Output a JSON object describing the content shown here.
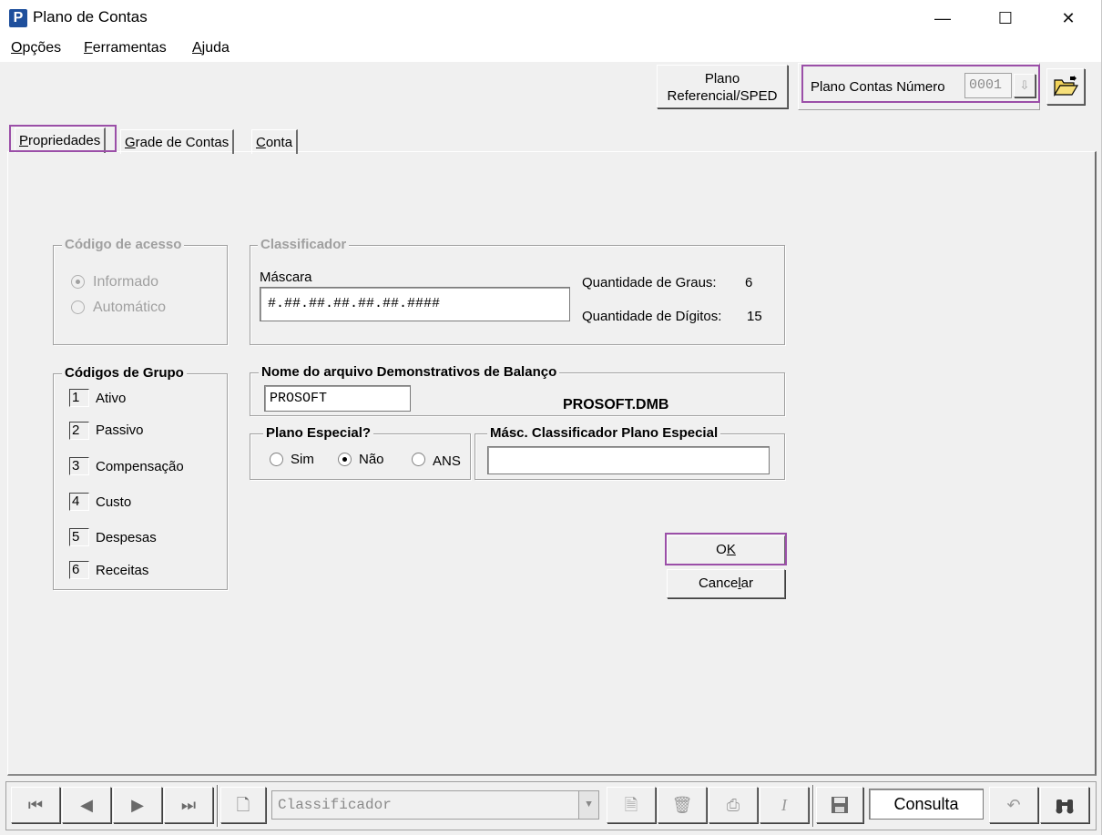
{
  "window": {
    "title": "Plano de Contas",
    "app_icon": "P",
    "minimize": "—",
    "maximize": "☐",
    "close": "✕"
  },
  "menu": [
    {
      "accel": "O",
      "rest": "pções"
    },
    {
      "accel": "F",
      "rest": "erramentas"
    },
    {
      "accel": "A",
      "rest": "juda"
    }
  ],
  "header": {
    "sped_line1": "Plano",
    "sped_line2": "Referencial/SPED",
    "plano_numero_label": "Plano Contas Número",
    "plano_numero_value": "0001",
    "spin_icon": "download-arrow-icon",
    "open_icon": "open-folder-icon"
  },
  "tabs": [
    {
      "accel": "P",
      "rest": "ropriedades",
      "active": true
    },
    {
      "accel": "G",
      "rest": "rade de Contas",
      "active": false
    },
    {
      "accel": "C",
      "rest": "onta",
      "active": false
    }
  ],
  "codigo_acesso": {
    "legend": "Código de acesso",
    "opt_informado": "Informado",
    "opt_automatico": "Automático",
    "selected": "Informado",
    "enabled": false
  },
  "classificador": {
    "legend": "Classificador",
    "mascara_label": "Máscara",
    "mascara_value": "#.##.##.##.##.##.####",
    "graus_label": "Quantidade de Graus:",
    "graus_value": "6",
    "digitos_label": "Quantidade de Dígitos:",
    "digitos_value": "15"
  },
  "codigos_grupo": {
    "legend": "Códigos de Grupo",
    "items": [
      {
        "num": "1",
        "label": "Ativo"
      },
      {
        "num": "2",
        "label": "Passivo"
      },
      {
        "num": "3",
        "label": "Compensação"
      },
      {
        "num": "4",
        "label": "Custo"
      },
      {
        "num": "5",
        "label": "Despesas"
      },
      {
        "num": "6",
        "label": "Receitas"
      }
    ]
  },
  "demonstrativos": {
    "legend": "Nome do arquivo Demonstrativos de Balanço",
    "value": "PROSOFT",
    "file": "PROSOFT.DMB"
  },
  "plano_especial": {
    "legend": "Plano Especial?",
    "opt_sim": "Sim",
    "opt_nao": "Não",
    "opt_ans": "ANS",
    "selected": "Não"
  },
  "masc_especial": {
    "legend": "Másc. Classificador Plano Especial",
    "value": ""
  },
  "actions": {
    "ok_accel_before": "O",
    "ok_accel": "K",
    "cancel_before": "Cance",
    "cancel_accel": "l",
    "cancel_after": "ar"
  },
  "toolbar": {
    "first_icon": "first-record-icon",
    "prev_icon": "previous-record-icon",
    "next_icon": "next-record-icon",
    "last_icon": "last-record-icon",
    "new_icon": "new-document-icon",
    "combo_value": "Classificador",
    "edit_icon": "edit-document-icon",
    "delete_icon": "delete-icon",
    "print_icon": "print-icon",
    "italic_icon": "italic-icon",
    "save_icon": "save-icon",
    "status": "Consulta",
    "undo_icon": "undo-icon",
    "search_icon": "binoculars-icon"
  }
}
